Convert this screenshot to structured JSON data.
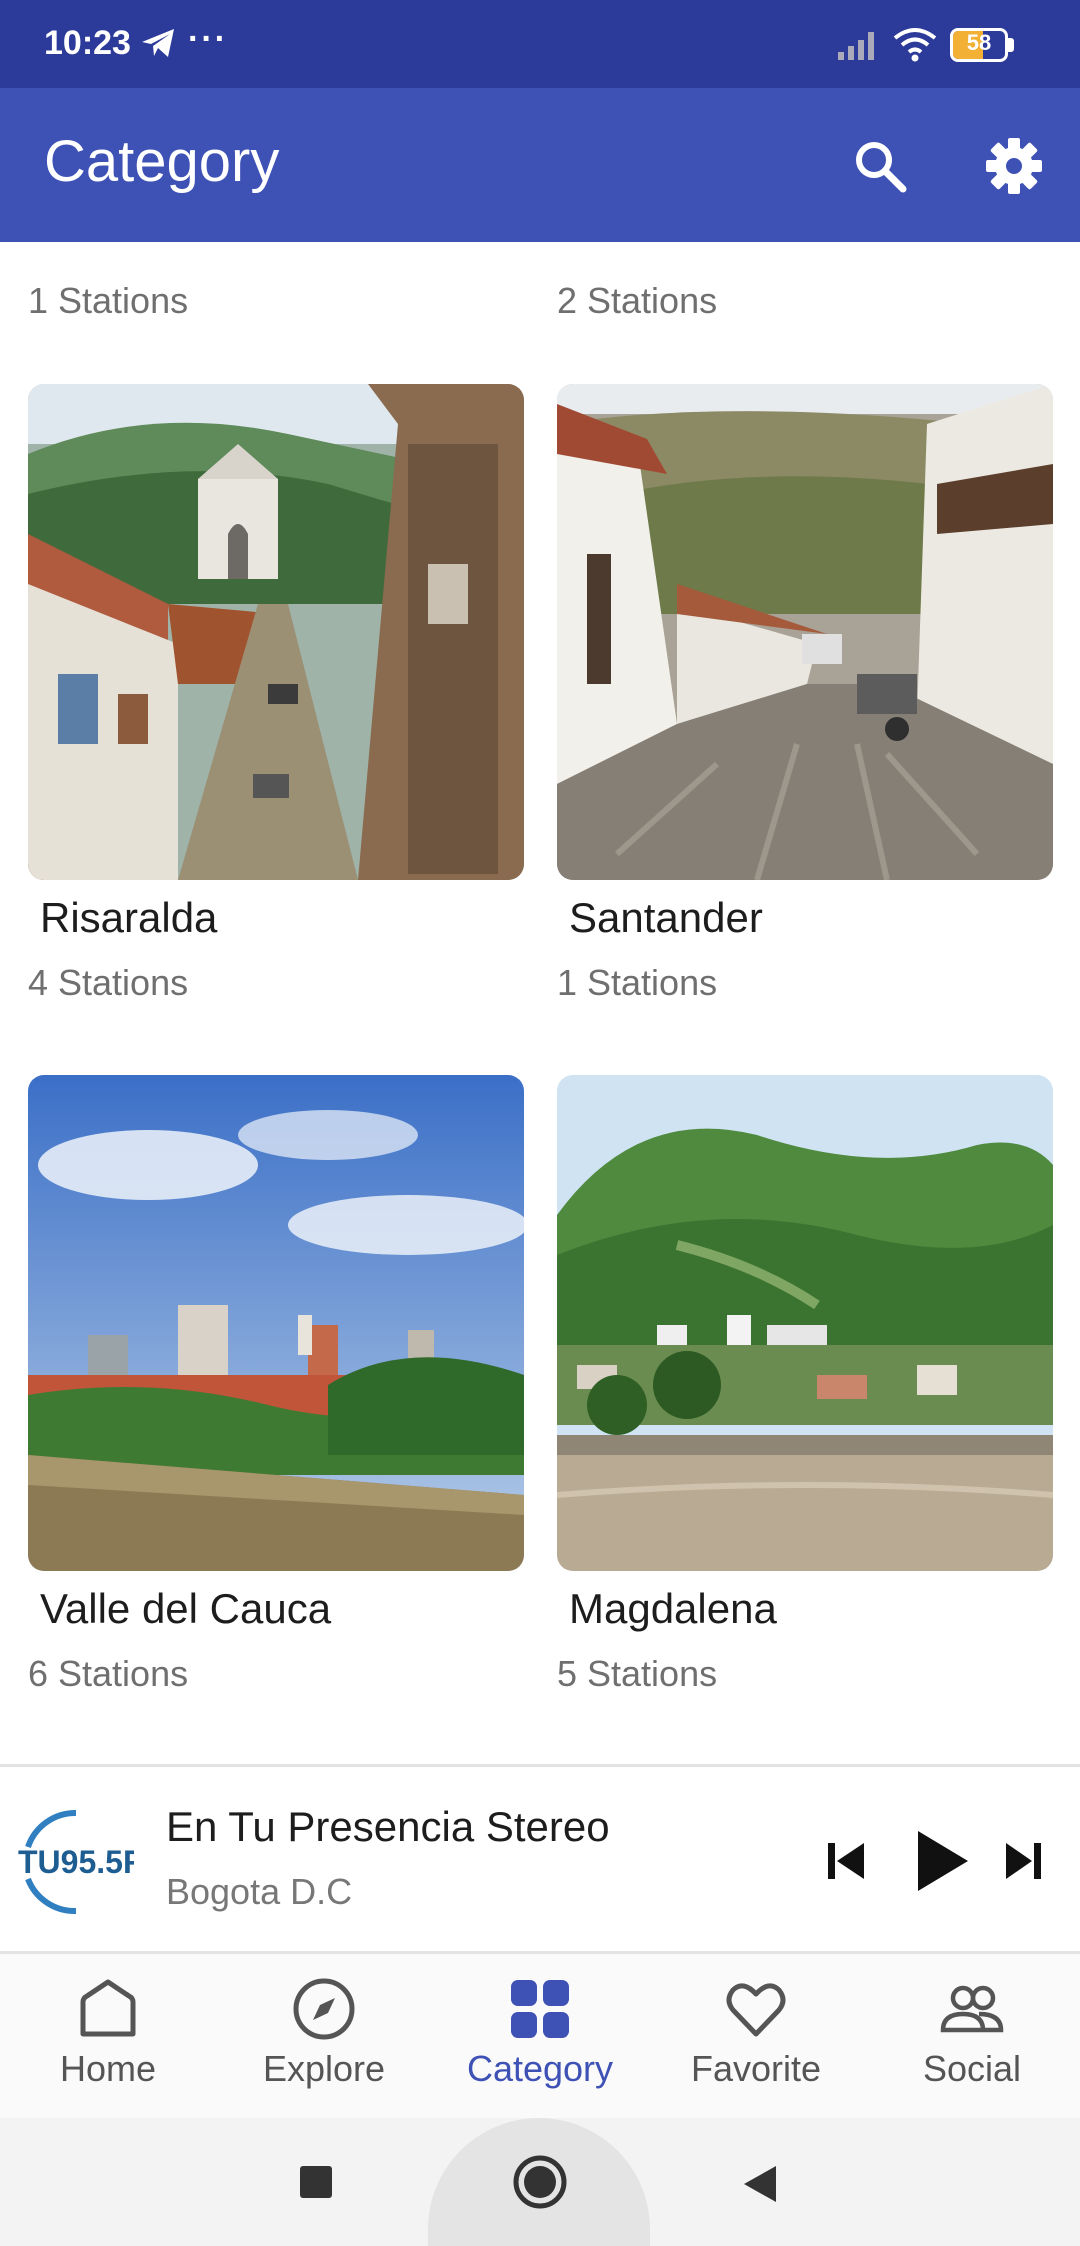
{
  "status_bar": {
    "time": "10:23",
    "overflow": "···",
    "battery_level": "58",
    "battery_fraction": 0.58,
    "icons": [
      "telegram-icon",
      "signal-icon",
      "wifi-icon",
      "battery-icon"
    ]
  },
  "app_bar": {
    "title": "Category",
    "icons": [
      "search-icon",
      "settings-gear-icon"
    ],
    "color": "#3e51b5"
  },
  "categories_partial": [
    {
      "count": "1 Stations"
    },
    {
      "count": "2 Stations"
    }
  ],
  "categories": [
    {
      "name": "Risaralda",
      "count": "4 Stations",
      "image": "colonial street with church"
    },
    {
      "name": "Santander",
      "count": "1 Stations",
      "image": "cobblestone colonial street"
    },
    {
      "name": "Valle del Cauca",
      "count": "6 Stations",
      "image": "city skyline view"
    },
    {
      "name": "Magdalena",
      "count": "5 Stations",
      "image": "town by river and green mountains"
    }
  ],
  "player": {
    "station": "En Tu Presencia Stereo",
    "city": "Bogota D.C",
    "logo_text": "TU95.5F",
    "icons": [
      "skip-previous-icon",
      "play-icon",
      "skip-next-icon"
    ]
  },
  "bottom_nav": {
    "items": [
      {
        "label": "Home",
        "icon": "home-icon"
      },
      {
        "label": "Explore",
        "icon": "compass-icon"
      },
      {
        "label": "Category",
        "icon": "grid-icon",
        "active": true
      },
      {
        "label": "Favorite",
        "icon": "heart-icon"
      },
      {
        "label": "Social",
        "icon": "people-icon"
      }
    ],
    "active_color": "#3e51b5"
  },
  "system_nav": {
    "icons": [
      "recents-square-icon",
      "home-circle-icon",
      "back-triangle-icon"
    ]
  }
}
